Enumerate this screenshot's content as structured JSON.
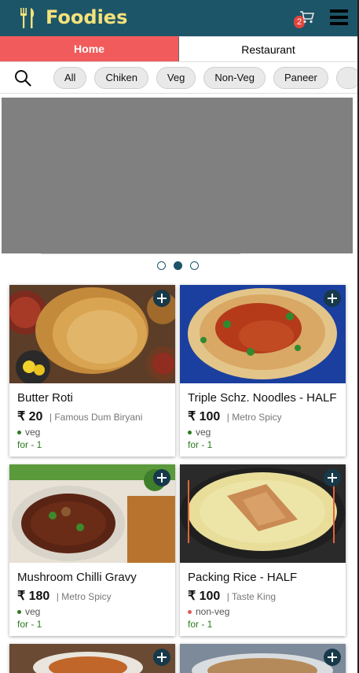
{
  "header": {
    "brand": "Foodies",
    "logo_icon": "fork-knife-icon",
    "cart_icon": "cart-icon",
    "cart_count": "2",
    "menu_icon": "hamburger-menu-icon",
    "bg_color": "#1d5568",
    "brand_color": "#f4e27a"
  },
  "tabs": [
    {
      "label": "Home",
      "active": true
    },
    {
      "label": "Restaurant",
      "active": false
    }
  ],
  "filters": {
    "search_icon": "search-icon",
    "chips": [
      "All",
      "Chiken",
      "Veg",
      "Non-Veg",
      "Paneer"
    ]
  },
  "carousel": {
    "slide_count": 3,
    "active_index": 1
  },
  "items": [
    {
      "name": "Butter Roti",
      "price": "₹ 20",
      "restaurant": "| Famous Dum Biryani",
      "diet": "veg",
      "diet_color": "#2a7a1e",
      "for": "for - 1"
    },
    {
      "name": "Triple Schz. Noodles - HALF",
      "price": "₹ 100",
      "restaurant": "| Metro Spicy",
      "diet": "veg",
      "diet_color": "#2a7a1e",
      "for": "for - 1"
    },
    {
      "name": "Mushroom Chilli Gravy",
      "price": "₹ 180",
      "restaurant": "| Metro Spicy",
      "diet": "veg",
      "diet_color": "#2a7a1e",
      "for": "for - 1"
    },
    {
      "name": "Packing Rice - HALF",
      "price": "₹ 100",
      "restaurant": "| Taste King",
      "diet": "non-veg",
      "diet_color": "#e05a5a",
      "for": "for - 1"
    }
  ]
}
